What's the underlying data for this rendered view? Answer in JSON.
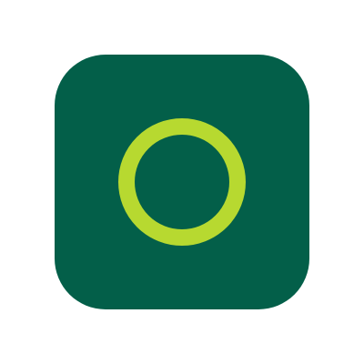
{
  "app_icon": {
    "icon": "ring-icon",
    "background_color": "#035f49",
    "ring_color": "#b7d930"
  },
  "page": {
    "background_color": "#ffffff"
  }
}
